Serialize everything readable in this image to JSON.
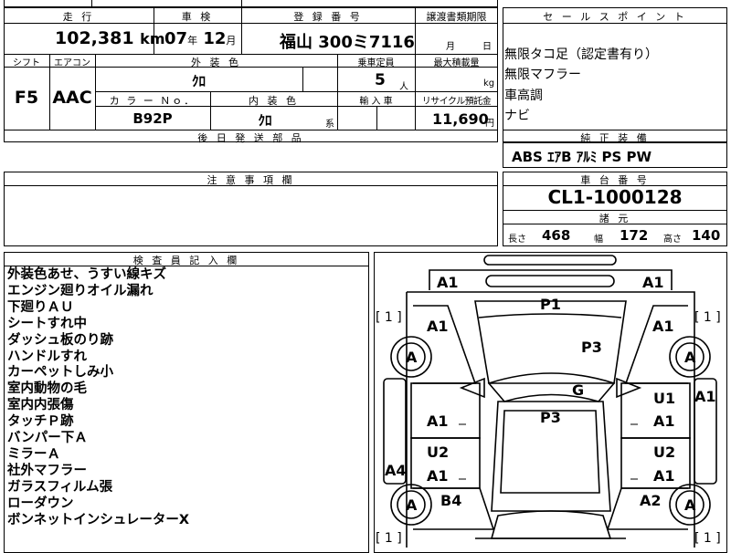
{
  "sheet": {
    "mileage": {
      "label": "走 行",
      "value": "102,381",
      "unit": "km"
    },
    "inspection": {
      "label": "車 検",
      "year": "07",
      "year_unit": "年",
      "month": "12",
      "month_unit": "月"
    },
    "registration": {
      "label": "登 録 番 号",
      "value": "福山 300ミ7116"
    },
    "transfer_docs": {
      "label": "譲渡書類期限",
      "month_unit": "月",
      "day_unit": "日"
    },
    "shift": {
      "label": "シフト",
      "value": "F5"
    },
    "aircon": {
      "label": "エアコン",
      "value": "AAC"
    },
    "exterior_color": {
      "label": "外 装 色",
      "value": "ｸﾛ"
    },
    "capacity": {
      "label": "乗車定員",
      "value": "5",
      "unit": "人"
    },
    "max_load": {
      "label": "最大積載量",
      "value": "",
      "unit": "kg"
    },
    "color_no": {
      "label": "カ ラ ー Ｎｏ．",
      "value": "B92P"
    },
    "interior_color": {
      "label": "内 装 色",
      "value": "ｸﾛ",
      "suffix": "系"
    },
    "import": {
      "label": "輸 入 車",
      "value": ""
    },
    "recycle": {
      "label": "リサイクル預託金",
      "value": "11,690",
      "unit": "円"
    },
    "later_parts": {
      "label": "後 日 発 送 部 品",
      "value": ""
    },
    "caution": {
      "label": "注 意 事 項 欄",
      "value": ""
    },
    "inspector": {
      "label": "検 査 員 記 入 欄",
      "lines": [
        "外装色あせ、うすい線キズ",
        "エンジン廻りオイル漏れ",
        "下廻りＡＵ",
        "シートすれ中",
        "ダッシュ板のり跡",
        "ハンドルすれ",
        "カーペットしみ小",
        "室内動物の毛",
        "室内内張傷",
        "タッチＰ跡",
        "バンパー下Ａ",
        "ミラーＡ",
        "社外マフラー",
        "ガラスフィルム張",
        "ローダウン",
        "ボンネットインシュレーターX"
      ]
    }
  },
  "sales_points": {
    "label": "セ ー ル ス ポ イ ン ト",
    "items": [
      "無限タコ足（認定書有り）",
      "無限マフラー",
      "車高調",
      "ナビ"
    ]
  },
  "equipment": {
    "label": "純 正 装 備",
    "value": "ABS ｴｱB ｱﾙﾐ PS PW"
  },
  "chassis": {
    "label": "車 台 番 号",
    "value": "CL1-1000128"
  },
  "dimensions": {
    "label": "諸 元",
    "length_label": "長さ",
    "length": "468",
    "width_label": "幅",
    "width": "172",
    "height_label": "高さ",
    "height": "140"
  },
  "diagram": {
    "bracket_left_top": "[ 1 ]",
    "bracket_right_top": "[ 1 ]",
    "bracket_left_bottom": "[ 1 ]",
    "bracket_right_bottom": "[ 1 ]",
    "marks": {
      "front_left_corner": "A1",
      "front_right_corner": "A1",
      "hood": "P1",
      "left_front_fender": "A1",
      "right_front_fender": "A1",
      "left_front_wheel": "A",
      "right_front_wheel": "A",
      "windshield": "P3",
      "right_panel": "A1",
      "glass_center": "G",
      "roof": "P3",
      "right_front_door_1": "U1",
      "right_front_door_2": "A1",
      "left_front_door": "A1",
      "left_rocker": "A4",
      "left_rear_door_1": "U2",
      "left_rear_door_2": "A1",
      "right_rear_door_1": "U2",
      "right_rear_door_2": "A1",
      "left_rear_quarter": "B4",
      "right_rear_quarter": "A2",
      "left_rear_wheel": "A",
      "right_rear_wheel": "A"
    }
  }
}
